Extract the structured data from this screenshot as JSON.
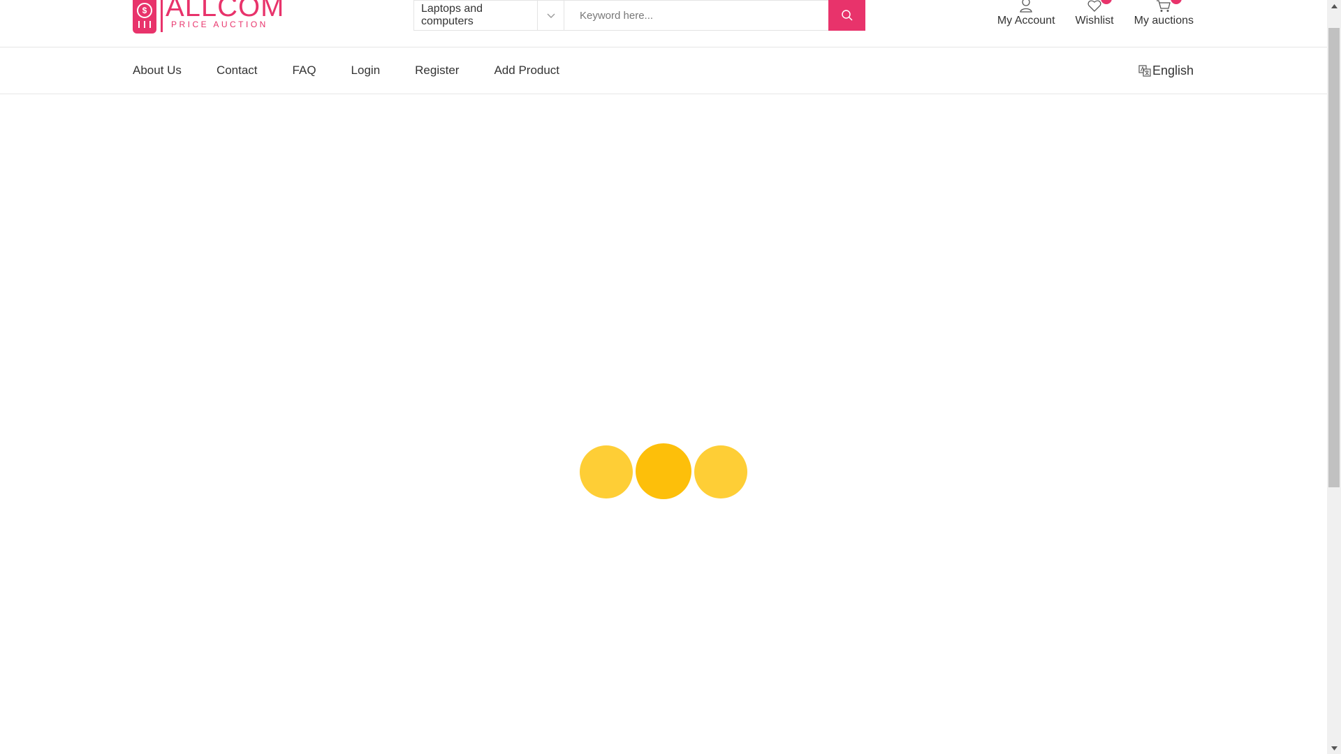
{
  "brand": {
    "name": "ALLCOM",
    "tagline": "PRICE AUCTION",
    "coin_symbol": "$",
    "color": "#e8336b"
  },
  "search": {
    "category_value": "Laptops and computers",
    "keyword_placeholder": "Keyword here...",
    "button_icon": "search-icon"
  },
  "header_links": [
    {
      "label": "My Account",
      "icon": "user-icon"
    },
    {
      "label": "Wishlist",
      "icon": "heart-icon"
    },
    {
      "label": "My auctions",
      "icon": "cart-icon"
    }
  ],
  "nav": {
    "items": [
      "About Us",
      "Contact",
      "FAQ",
      "Login",
      "Register",
      "Add Product"
    ],
    "language": "English",
    "language_icon": "translate-icon"
  },
  "loader": {
    "colors": [
      "#fece36",
      "#fdbf0a",
      "#fece36"
    ]
  }
}
